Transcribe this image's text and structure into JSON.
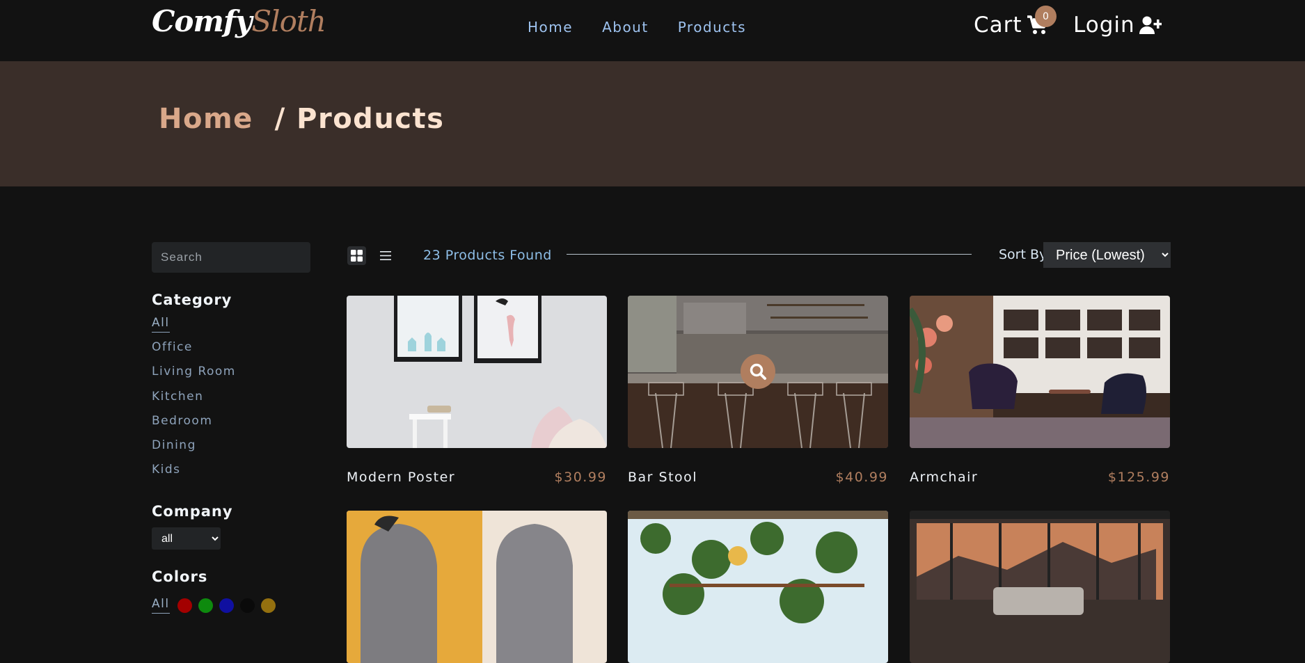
{
  "nav": {
    "logo_first": "Comfy",
    "logo_second": "Sloth",
    "links": [
      "Home",
      "About",
      "Products"
    ],
    "cart_label": "Cart",
    "cart_count": "0",
    "login_label": "Login"
  },
  "hero": {
    "home": "Home",
    "current": "/ Products"
  },
  "filters": {
    "search_placeholder": "Search",
    "category_title": "Category",
    "categories": [
      "All",
      "Office",
      "Living Room",
      "Kitchen",
      "Bedroom",
      "Dining",
      "Kids"
    ],
    "company_title": "Company",
    "company_value": "all",
    "colors_title": "Colors",
    "colors_all": "All",
    "colors": [
      "#ff0000",
      "#00ff00",
      "#0000ff",
      "#000000",
      "#ffb900"
    ]
  },
  "toolbar": {
    "count": "23 Products Found",
    "sort_label": "Sort By",
    "sort_value": "Price (Lowest)",
    "grid_icon": "grid-view-icon",
    "list_icon": "list-view-icon"
  },
  "products": [
    {
      "name": "Modern Poster",
      "price": "$30.99"
    },
    {
      "name": "Bar Stool",
      "price": "$40.99"
    },
    {
      "name": "Armchair",
      "price": "$125.99"
    }
  ],
  "accent": "#b07e5f"
}
